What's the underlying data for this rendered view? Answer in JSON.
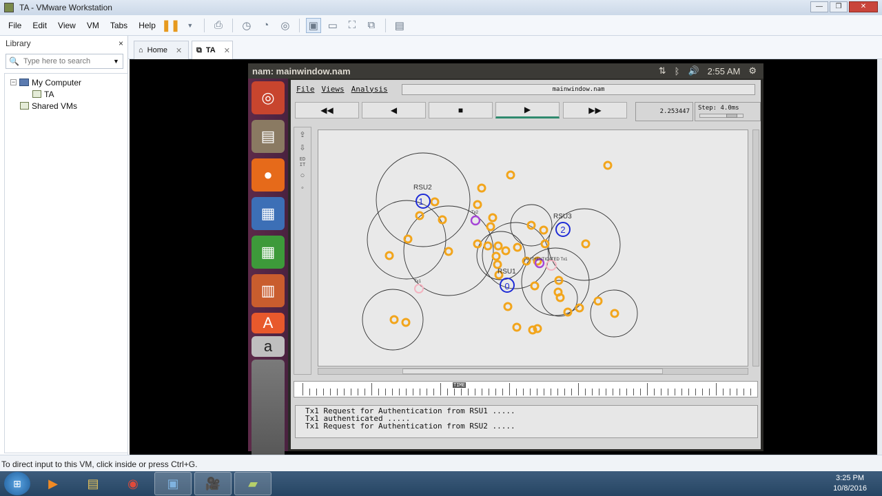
{
  "window": {
    "title": "TA - VMware Workstation"
  },
  "menu": {
    "file": "File",
    "edit": "Edit",
    "view": "View",
    "vm": "VM",
    "tabs": "Tabs",
    "help": "Help"
  },
  "library": {
    "title": "Library",
    "close": "×",
    "search_placeholder": "Type here to search",
    "tree": {
      "root": "My Computer",
      "vm": "TA",
      "shared": "Shared VMs"
    }
  },
  "tabs": [
    {
      "label": "Home"
    },
    {
      "label": "TA"
    }
  ],
  "guest": {
    "window_title": "nam: mainwindow.nam",
    "time": "2:55 AM"
  },
  "nam": {
    "menu": {
      "file": "File",
      "views": "Views",
      "analysis": "Analysis"
    },
    "file_label": "mainwindow.nam",
    "time": "2.253447",
    "step": "Step: 4.0ms",
    "edit_label": "ED\nIT",
    "time_marker": "TIME",
    "nodes": [
      {
        "label": "RSU2",
        "id": "1"
      },
      {
        "label": "RSU3",
        "id": "2"
      },
      {
        "label": "RSU1",
        "id": "0"
      }
    ],
    "node_labels": {
      "tx1_a": "Tx1",
      "tx2": "Tx2",
      "tx1_b": "Tx1",
      "auth": "AUTHENTICATED Tx1"
    },
    "log": [
      "Tx1 Request for Authentication from RSU1 .....",
      "Tx1 authenticated .....",
      "Tx1 Request for Authentication from RSU2 ....."
    ]
  },
  "status": {
    "text": "To direct input to this VM, click inside or press Ctrl+G."
  },
  "clock": {
    "time": "3:25 PM",
    "date": "10/8/2016"
  },
  "colors": {
    "vehicle": "#f2a51c",
    "rsu": "#1d2ad6",
    "tx": "#a545d6",
    "highlight": "#f4b3c0"
  }
}
